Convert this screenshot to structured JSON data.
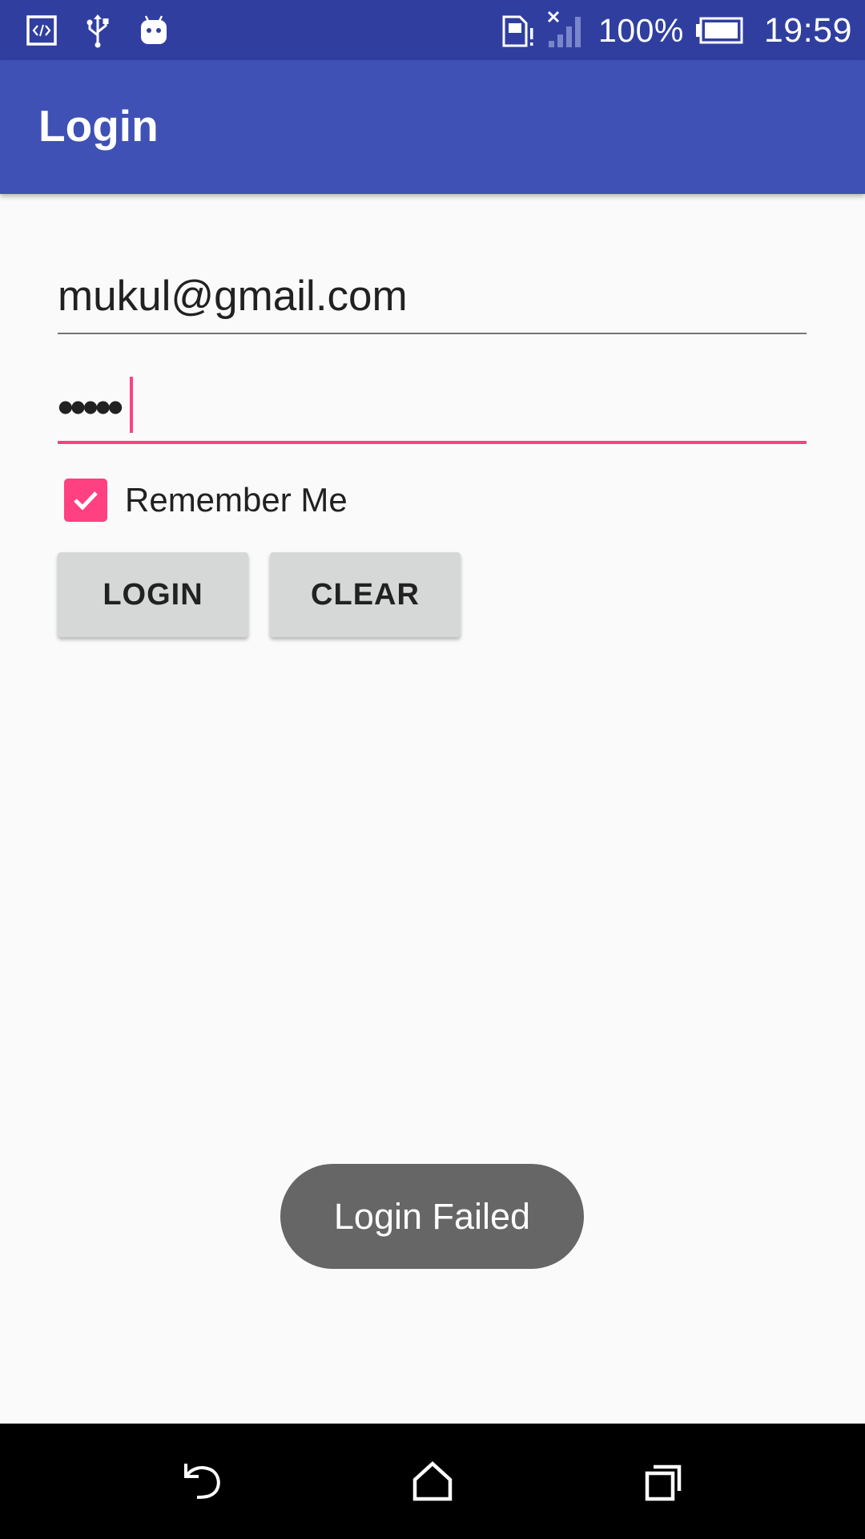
{
  "status_bar": {
    "left_icons": [
      "code-icon",
      "usb-icon",
      "android-icon"
    ],
    "right_icons": [
      "sim-alert-icon",
      "signal-no-service-icon",
      "battery-icon"
    ],
    "battery_percent": "100%",
    "time": "19:59",
    "background_color": "#303f9f"
  },
  "toolbar": {
    "title": "Login",
    "background_color": "#3f51b5"
  },
  "form": {
    "email": {
      "value": "mukul@gmail.com"
    },
    "password": {
      "masked_value": "•••••",
      "focused": true
    },
    "remember_me": {
      "label": "Remember Me",
      "checked": true
    },
    "buttons": {
      "login_label": "LOGIN",
      "clear_label": "CLEAR"
    },
    "accent_color": "#ff4081"
  },
  "toast": {
    "message": "Login Failed"
  },
  "nav_bar": {
    "icons": [
      "back-icon",
      "home-icon",
      "recents-icon"
    ]
  }
}
